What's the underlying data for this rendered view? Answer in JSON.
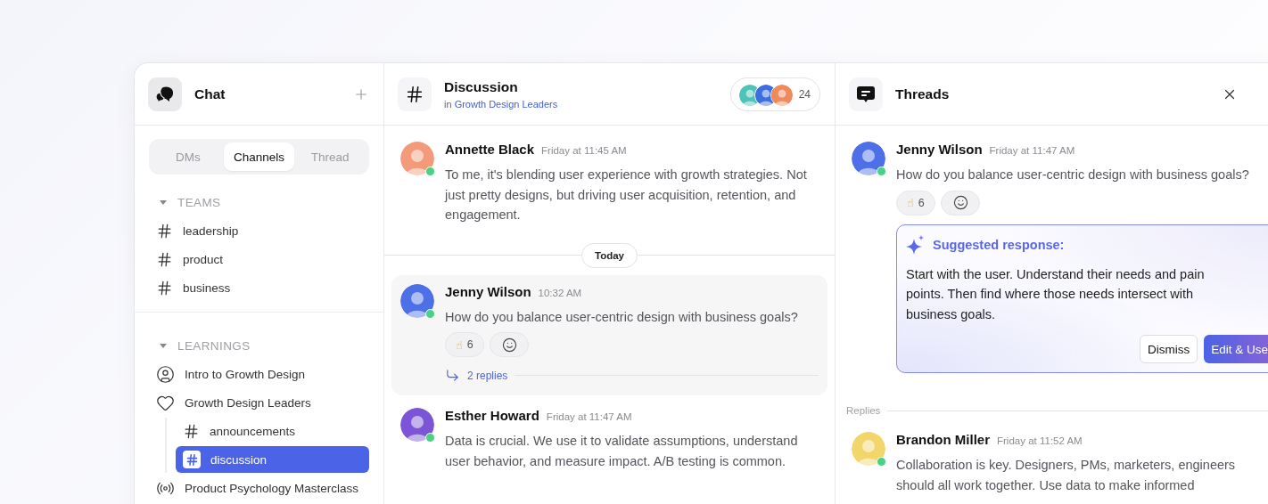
{
  "sidebar": {
    "title": "Chat",
    "tabs": [
      {
        "label": "DMs",
        "selected": false
      },
      {
        "label": "Channels",
        "selected": true
      },
      {
        "label": "Thread",
        "selected": false
      }
    ],
    "sections": [
      {
        "title": "TEAMS",
        "expanded": true,
        "items": [
          {
            "kind": "channel",
            "label": "leadership",
            "selected": false
          },
          {
            "kind": "channel",
            "label": "product",
            "selected": false
          },
          {
            "kind": "channel",
            "label": "business",
            "selected": false
          }
        ]
      },
      {
        "title": "LEARNINGS",
        "expanded": true,
        "items": [
          {
            "kind": "course",
            "label": "Intro to Growth Design",
            "selected": false
          },
          {
            "kind": "community",
            "label": "Growth Design Leaders",
            "selected": false,
            "children": [
              {
                "kind": "channel",
                "label": "announcements",
                "selected": false
              },
              {
                "kind": "channel",
                "label": "discussion",
                "selected": true
              }
            ]
          },
          {
            "kind": "broadcast",
            "label": "Product Psychology Masterclass",
            "selected": false
          }
        ]
      }
    ]
  },
  "channel": {
    "title": "Discussion",
    "context_prefix": "in",
    "context_link": "Growth Design Leaders",
    "members": [
      {
        "color": "#4fc3b8"
      },
      {
        "color": "#3b6fe0"
      },
      {
        "color": "#f08a5d"
      }
    ],
    "member_count": "24",
    "feed": [
      {
        "kind": "message",
        "author": "Annette Black",
        "time": "Friday at 11:45 AM",
        "text": "To me, it's blending user experience with growth strategies. Not just pretty designs, but driving user acquisition, retention, and engagement.",
        "online": true,
        "highlighted": false,
        "color": "#f29a7a"
      },
      {
        "kind": "divider",
        "label": "Today"
      },
      {
        "kind": "message",
        "author": "Jenny Wilson",
        "time": "10:32 AM",
        "text": "How do you balance user-centric design with business goals?",
        "online": true,
        "highlighted": true,
        "color": "#4d6fe8",
        "reactions": [
          {
            "emoji": "☝",
            "count": "6"
          }
        ],
        "replies": "2 replies"
      },
      {
        "kind": "message",
        "author": "Esther Howard",
        "time": "Friday at 11:47 AM",
        "text": "Data is crucial. We use it to validate assumptions, understand user behavior, and measure impact. A/B testing is common.",
        "online": true,
        "highlighted": false,
        "color": "#7b55d6"
      }
    ]
  },
  "threads": {
    "title": "Threads",
    "message": {
      "author": "Jenny Wilson",
      "time": "Friday at 11:47 AM",
      "text": "How do you balance user-centric design with business goals?",
      "online": true,
      "color": "#4d6fe8",
      "reactions": [
        {
          "emoji": "☝",
          "count": "6"
        }
      ]
    },
    "suggestion": {
      "title": "Suggested response:",
      "text": "Start with the user. Understand their needs and pain points. Then find where those needs intersect with business goals.",
      "buttons": [
        {
          "kind": "secondary",
          "label": "Dismiss"
        },
        {
          "kind": "primary",
          "label": "Edit & Use"
        }
      ]
    },
    "replies_label": "Replies",
    "replies": [
      {
        "author": "Brandon Miller",
        "time": "Friday at 11:52 AM",
        "text": "Collaboration is key. Designers, PMs, marketers, engineers should all work together. Use data to make informed",
        "online": true,
        "color": "#f2d56b"
      }
    ]
  }
}
